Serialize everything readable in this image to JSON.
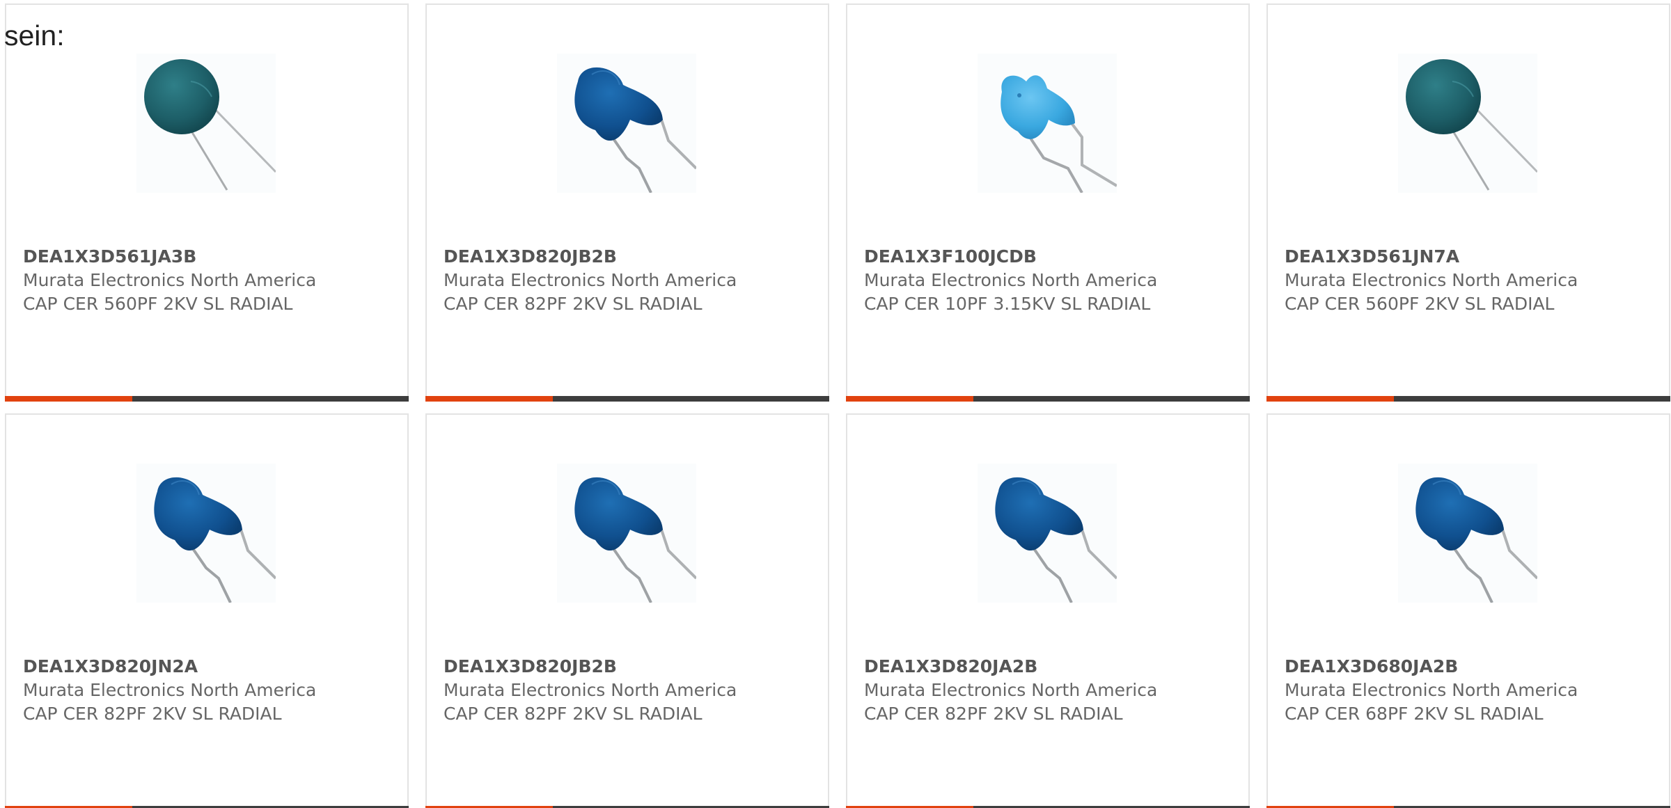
{
  "lead_text": "sein:",
  "colors": {
    "accent": "#e1420f",
    "bar_dark": "#3d3d3d",
    "card_border": "#e3e3e3",
    "text_gray": "#666666"
  },
  "products": [
    {
      "part_number": "DEA1X3D561JA3B",
      "manufacturer": "Murata Electronics North America",
      "description": "CAP CER 560PF 2KV SL RADIAL",
      "image": "disc-capacitor-teal-icon"
    },
    {
      "part_number": "DEA1X3D820JB2B",
      "manufacturer": "Murata Electronics North America",
      "description": "CAP CER 82PF 2KV SL RADIAL",
      "image": "disc-capacitor-blue-icon"
    },
    {
      "part_number": "DEA1X3F100JCDB",
      "manufacturer": "Murata Electronics North America",
      "description": "CAP CER 10PF 3.15KV SL RADIAL",
      "image": "disc-capacitor-lightblue-icon"
    },
    {
      "part_number": "DEA1X3D561JN7A",
      "manufacturer": "Murata Electronics North America",
      "description": "CAP CER 560PF 2KV SL RADIAL",
      "image": "disc-capacitor-teal-icon"
    },
    {
      "part_number": "DEA1X3D820JN2A",
      "manufacturer": "Murata Electronics North America",
      "description": "CAP CER 82PF 2KV SL RADIAL",
      "image": "disc-capacitor-blue-icon"
    },
    {
      "part_number": "DEA1X3D820JB2B",
      "manufacturer": "Murata Electronics North America",
      "description": "CAP CER 82PF 2KV SL RADIAL",
      "image": "disc-capacitor-blue-icon"
    },
    {
      "part_number": "DEA1X3D820JA2B",
      "manufacturer": "Murata Electronics North America",
      "description": "CAP CER 82PF 2KV SL RADIAL",
      "image": "disc-capacitor-blue-icon"
    },
    {
      "part_number": "DEA1X3D680JA2B",
      "manufacturer": "Murata Electronics North America",
      "description": "CAP CER 68PF 2KV SL RADIAL",
      "image": "disc-capacitor-blue-icon"
    }
  ]
}
